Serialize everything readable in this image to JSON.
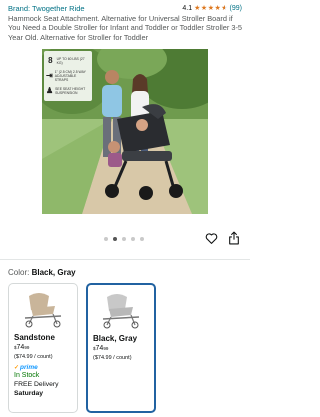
{
  "header": {
    "brand": "Brand: Twogether Ride",
    "rating_value": "4.1",
    "rating_stars": 4.1,
    "review_count": "(99)",
    "title": "Hammock Seat Attachment. Alternative for Universal Stroller Board if You Need a Double Stroller for Infant and Toddler or Toddler Stroller 3-5 Year Old. Alternative for Stroller for Toddler"
  },
  "image_features": [
    {
      "icon": "8",
      "text": "UP TO 60 LBS (27 KG)"
    },
    {
      "icon": "⇥",
      "text": "1\" (2.5 CM) 2.5 WAY ADJUSTABLE STRAPS"
    },
    {
      "icon": "♟",
      "text": "SEE SEAT HEIGHT SUSPENSION"
    }
  ],
  "carousel": {
    "total": 5,
    "active_index": 1
  },
  "actions": {
    "favorite_icon": "heart-icon",
    "share_icon": "share-icon"
  },
  "color": {
    "label": "Color:",
    "value": "Black, Gray"
  },
  "variants": [
    {
      "name": "Sandstone",
      "price_symbol": "$",
      "price_whole": "74",
      "price_cents": "99",
      "per_unit": "($74.99 / count)",
      "prime_label": "prime",
      "stock": "In Stock",
      "delivery": "FREE Delivery",
      "delivery_day": "Saturday",
      "selected": false
    },
    {
      "name": "Black, Gray",
      "price_symbol": "$",
      "price_whole": "74",
      "price_cents": "99",
      "per_unit": "($74.99 / count)",
      "selected": true
    }
  ],
  "colors": {
    "link": "#007185",
    "star": "#de7921",
    "selected_border": "#2162a1",
    "in_stock": "#007600",
    "prime": "#1399ff"
  }
}
